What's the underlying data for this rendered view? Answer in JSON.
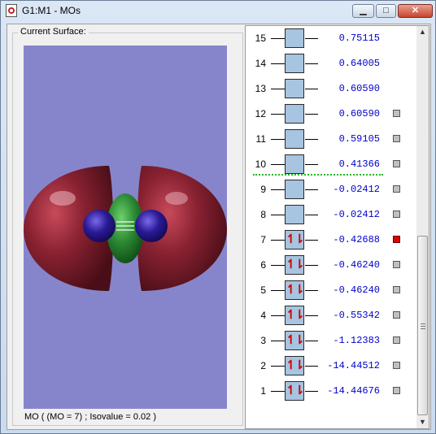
{
  "window": {
    "title": "G1:M1 - MOs",
    "minimize_glyph": "▁",
    "maximize_glyph": "□",
    "close_glyph": "✕"
  },
  "surface_panel": {
    "label": "Current Surface:",
    "caption": "MO ( (MO = 7) ; Isovalue = 0.02 )"
  },
  "orbitals": [
    {
      "number": "15",
      "energy": "0.75115",
      "occupied": false,
      "checkbox": false,
      "selected": false
    },
    {
      "number": "14",
      "energy": "0.64005",
      "occupied": false,
      "checkbox": false,
      "selected": false
    },
    {
      "number": "13",
      "energy": "0.60590",
      "occupied": false,
      "checkbox": false,
      "selected": false
    },
    {
      "number": "12",
      "energy": "0.60590",
      "occupied": false,
      "checkbox": true,
      "selected": false
    },
    {
      "number": "11",
      "energy": "0.59105",
      "occupied": false,
      "checkbox": true,
      "selected": false
    },
    {
      "number": "10",
      "energy": "0.41366",
      "occupied": false,
      "checkbox": true,
      "selected": false
    },
    {
      "number": "9",
      "energy": "-0.02412",
      "occupied": false,
      "checkbox": true,
      "selected": false
    },
    {
      "number": "8",
      "energy": "-0.02412",
      "occupied": false,
      "checkbox": true,
      "selected": false
    },
    {
      "number": "7",
      "energy": "-0.42688",
      "occupied": true,
      "checkbox": true,
      "selected": true
    },
    {
      "number": "6",
      "energy": "-0.46240",
      "occupied": true,
      "checkbox": true,
      "selected": false
    },
    {
      "number": "5",
      "energy": "-0.46240",
      "occupied": true,
      "checkbox": true,
      "selected": false
    },
    {
      "number": "4",
      "energy": "-0.55342",
      "occupied": true,
      "checkbox": true,
      "selected": false
    },
    {
      "number": "3",
      "energy": "-1.12383",
      "occupied": true,
      "checkbox": true,
      "selected": false
    },
    {
      "number": "2",
      "energy": "-14.44512",
      "occupied": true,
      "checkbox": true,
      "selected": false
    },
    {
      "number": "1",
      "energy": "-14.44676",
      "occupied": true,
      "checkbox": true,
      "selected": false
    }
  ],
  "occupied_glyph": "↿⇂",
  "scrollbar": {
    "up_glyph": "▲",
    "down_glyph": "▼"
  },
  "colors": {
    "viewport_bg": "#8685cc",
    "lobe_red": "#7a1c2c",
    "lobe_green": "#2c8a34",
    "lobe_blue": "#2a1a96",
    "energy_text": "#0000c8",
    "selected_check": "#e00000",
    "homo_lumo_line": "#22bb22"
  }
}
